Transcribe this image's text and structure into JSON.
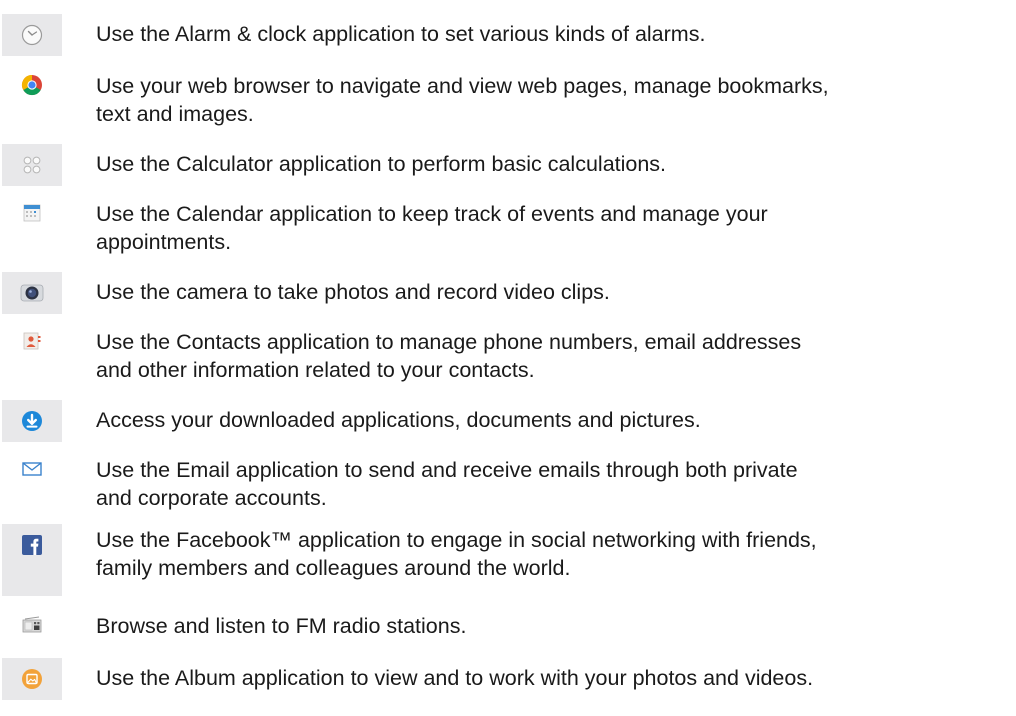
{
  "apps": [
    {
      "icon": "alarm-clock-icon",
      "description": "Use the Alarm & clock application to set various kinds of alarms."
    },
    {
      "icon": "chrome-browser-icon",
      "description": "Use your web browser to navigate and view web pages, manage bookmarks,\ntext and images."
    },
    {
      "icon": "calculator-icon",
      "description": "Use the Calculator application to perform basic calculations."
    },
    {
      "icon": "calendar-icon",
      "description": "Use the Calendar application to keep track of events and manage your\nappointments."
    },
    {
      "icon": "camera-icon",
      "description": "Use the camera to take photos and record video clips."
    },
    {
      "icon": "contacts-icon",
      "description": "Use the Contacts application to manage phone numbers, email addresses\nand other information related to your contacts."
    },
    {
      "icon": "download-icon",
      "description": "Access your downloaded applications, documents and pictures."
    },
    {
      "icon": "email-icon",
      "description": "Use the Email application to send and receive emails through both private\nand corporate accounts."
    },
    {
      "icon": "facebook-icon",
      "description": "Use the Facebook™ application to engage in social networking with friends,\nfamily members and colleagues around the world."
    },
    {
      "icon": "fm-radio-icon",
      "description": "Browse and listen to FM radio stations."
    },
    {
      "icon": "album-icon",
      "description": "Use the Album application to view and to work with your photos and videos."
    }
  ]
}
